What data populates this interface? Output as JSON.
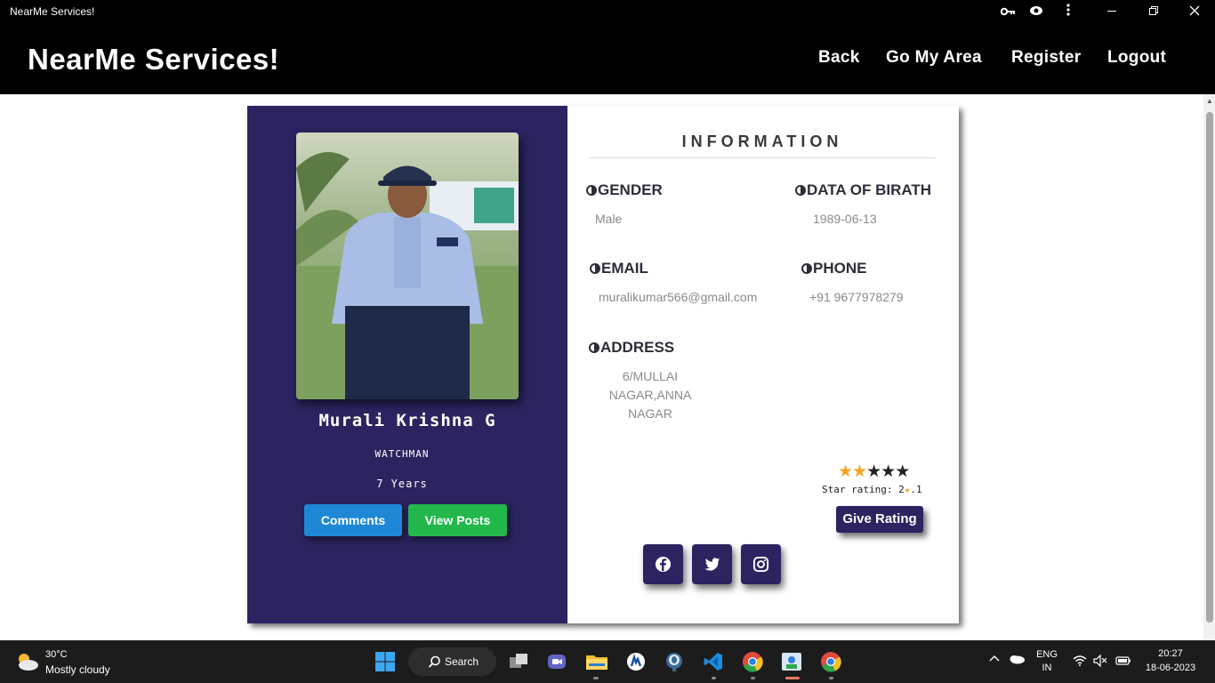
{
  "window": {
    "title": "NearMe Services!"
  },
  "header": {
    "brand": "NearMe Services!",
    "nav": [
      "Back",
      "Go My Area",
      "Register",
      "Logout"
    ]
  },
  "profile": {
    "name": "Murali Krishna G",
    "occupation": "WATCHMAN",
    "experience": "7 Years",
    "buttons": {
      "comments": "Comments",
      "posts": "View Posts"
    }
  },
  "info": {
    "title": "INFORMATION",
    "gender_label": "GENDER",
    "gender": "Male",
    "dob_label": "DATA OF BIRATH",
    "dob": "1989-06-13",
    "email_label": "EMAIL",
    "email": "muralikumar566@gmail.com",
    "phone_label": "PHONE",
    "phone": "+91 9677978279",
    "address_label": "ADDRESS",
    "address_lines": [
      "6/MULLAI",
      "NAGAR,ANNA",
      "NAGAR"
    ]
  },
  "rating": {
    "stars_filled": 2,
    "stars_total": 5,
    "label": "Star rating: 2",
    "suffix": ".1",
    "button": "Give Rating"
  },
  "social": [
    "facebook-icon",
    "twitter-icon",
    "instagram-icon"
  ],
  "taskbar": {
    "temperature": "30°C",
    "weather": "Mostly cloudy",
    "search": "Search",
    "lang1": "ENG",
    "lang2": "IN",
    "time": "20:27",
    "date": "18-06-2023"
  },
  "colors": {
    "panel": "#2b2460",
    "comments": "#1e88d6",
    "posts": "#22b84c",
    "star": "#f5a623"
  }
}
